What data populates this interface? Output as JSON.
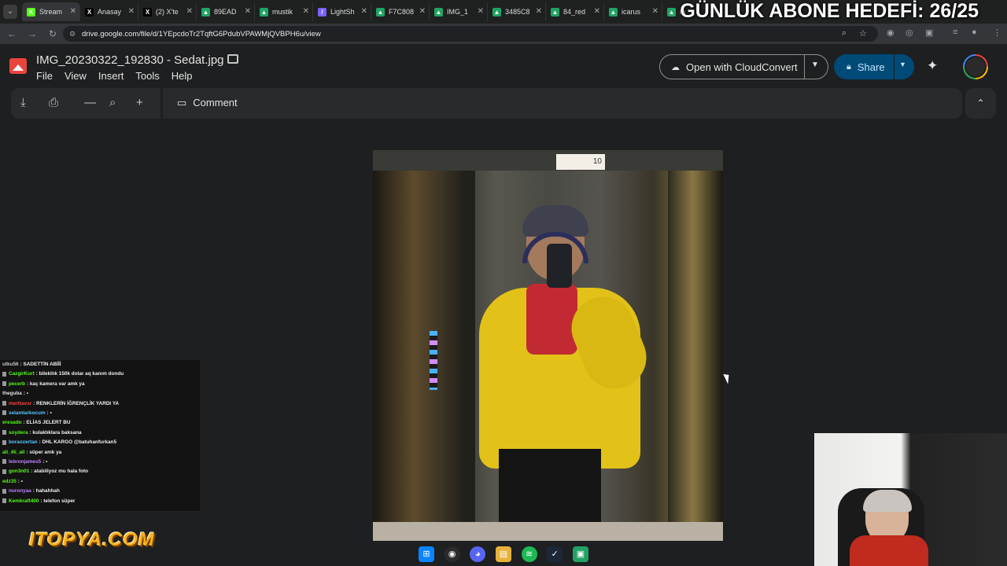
{
  "browser": {
    "tabs": [
      {
        "title": "Stream",
        "fav_color": "#53fc18",
        "fav_glyph": "K"
      },
      {
        "title": "Anasay",
        "fav_color": "#000000",
        "fav_glyph": "X"
      },
      {
        "title": "(2) X'te",
        "fav_color": "#000000",
        "fav_glyph": "X"
      },
      {
        "title": "89EAD",
        "fav_color": "#1fa463",
        "fav_glyph": "▲"
      },
      {
        "title": "mustik",
        "fav_color": "#1fa463",
        "fav_glyph": "▲"
      },
      {
        "title": "LightSh",
        "fav_color": "#7b61ff",
        "fav_glyph": "/"
      },
      {
        "title": "F7C808",
        "fav_color": "#1fa463",
        "fav_glyph": "▲"
      },
      {
        "title": "IMG_1",
        "fav_color": "#1fa463",
        "fav_glyph": "▲"
      },
      {
        "title": "3485C8",
        "fav_color": "#1fa463",
        "fav_glyph": "▲"
      },
      {
        "title": "84_red",
        "fav_color": "#1fa463",
        "fav_glyph": "▲"
      },
      {
        "title": "icarus",
        "fav_color": "#1fa463",
        "fav_glyph": "▲"
      },
      {
        "title": "m",
        "fav_color": "#1fa463",
        "fav_glyph": "▲"
      }
    ],
    "url": "drive.google.com/file/d/1YEpcdoTr2TqftG6PdubVPAWMjQVBPH6u/view"
  },
  "overlay": {
    "goal_text": "GÜNLÜK ABONE HEDEFİ: 26/25",
    "sponsor": "ITOPYA.COM"
  },
  "drive": {
    "file_name": "IMG_20230322_192830 - Sedat.jpg",
    "menu": [
      "File",
      "View",
      "Insert",
      "Tools",
      "Help"
    ],
    "open_with_label": "Open with CloudConvert",
    "share_label": "Share",
    "comment_label": "Comment"
  },
  "photo": {
    "elevator_sign": "10"
  },
  "chat": [
    {
      "user": "utku56",
      "user_color": "#c8c8c8",
      "message": ": SADETTİN ABİİİ"
    },
    {
      "user": "CazgirKurt",
      "user_color": "#53fc18",
      "message": ": bilekliık 150k dolar aq kanım dondu"
    },
    {
      "user": "pecerb",
      "user_color": "#53fc18",
      "message": ": kaç kamera var amk ya"
    },
    {
      "user": "theguba",
      "user_color": "#e0e0e0",
      "message": ": ▪"
    },
    {
      "user": "merttavsr",
      "user_color": "#ff4040",
      "message": ": RENKLERİN İĞRENÇLİK YARDI YA"
    },
    {
      "user": "selamlarkocum",
      "user_color": "#53c8ff",
      "message": ": ▪"
    },
    {
      "user": "eresado",
      "user_color": "#53fc18",
      "message": ": ELİAS JELERT BU"
    },
    {
      "user": "soydera",
      "user_color": "#53fc18",
      "message": ": kulaklıklara baksana"
    },
    {
      "user": "boraozertan",
      "user_color": "#53c8ff",
      "message": ": DHL KARGO @batuhanfurkan5"
    },
    {
      "user": "ali_4li_ali",
      "user_color": "#53fc18",
      "message": ": süper amk ya"
    },
    {
      "user": "lebronjames5",
      "user_color": "#c080ff",
      "message": ": ▪"
    },
    {
      "user": "gon3n01",
      "user_color": "#53fc18",
      "message": ": atabiliyoz mu hala foto"
    },
    {
      "user": "edz35",
      "user_color": "#53fc18",
      "message": ": ▪"
    },
    {
      "user": "nuronyaa",
      "user_color": "#c080ff",
      "message": ": hahahhah"
    },
    {
      "user": "Kemkraft400",
      "user_color": "#53fc18",
      "message": ": telefon süper"
    }
  ],
  "icons": {
    "download": "download-icon",
    "print": "print-icon",
    "zoom_out": "zoom-out-icon",
    "zoom_in": "zoom-in-icon",
    "add": "plus-icon",
    "comment": "comment-icon",
    "gemini": "gemini-sparkle-icon"
  }
}
